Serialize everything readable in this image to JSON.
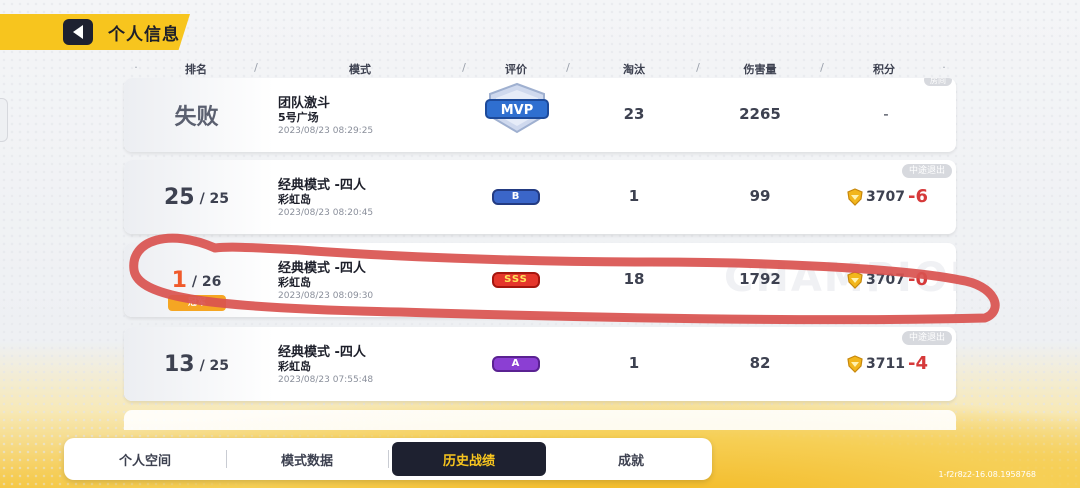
{
  "header": {
    "title": "个人信息"
  },
  "columns": [
    "排名",
    "模式",
    "评价",
    "淘汰",
    "伤害量",
    "积分"
  ],
  "rows": [
    {
      "rank": "失败",
      "mode": "团队激斗",
      "map": "5号广场",
      "time": "2023/08/23 08:29:25",
      "rating": "MVP",
      "elims": "23",
      "damage": "2265",
      "score": "-",
      "tag": "房间"
    },
    {
      "rank": "25",
      "total": "/ 25",
      "mode": "经典模式 -四人",
      "map": "彩虹岛",
      "time": "2023/08/23 08:20:45",
      "rating": "B",
      "elims": "1",
      "damage": "99",
      "score": "3707",
      "delta": "-6",
      "tag": "中途退出"
    },
    {
      "rank": "1",
      "total": "/ 26",
      "mode": "经典模式 -四人",
      "map": "彩虹岛",
      "time": "2023/08/23 08:09:30",
      "rating": "SSS",
      "elims": "18",
      "damage": "1792",
      "score": "3707",
      "delta": "-0",
      "watermark": "CHAMPION",
      "champ_tag": "冠军"
    },
    {
      "rank": "13",
      "total": "/ 25",
      "mode": "经典模式 -四人",
      "map": "彩虹岛",
      "time": "2023/08/23 07:55:48",
      "rating": "A",
      "elims": "1",
      "damage": "82",
      "score": "3711",
      "delta": "-4",
      "tag": "中途退出"
    }
  ],
  "tabs": [
    "个人空间",
    "模式数据",
    "历史战绩",
    "成就"
  ],
  "active_tab": "历史战绩",
  "build": "1-f2r8z2-16.08.1958768",
  "colors": {
    "accent": "#f7c51e",
    "dark": "#1e2130",
    "delta_red": "#d6393a",
    "annotation": "#d9534f"
  }
}
